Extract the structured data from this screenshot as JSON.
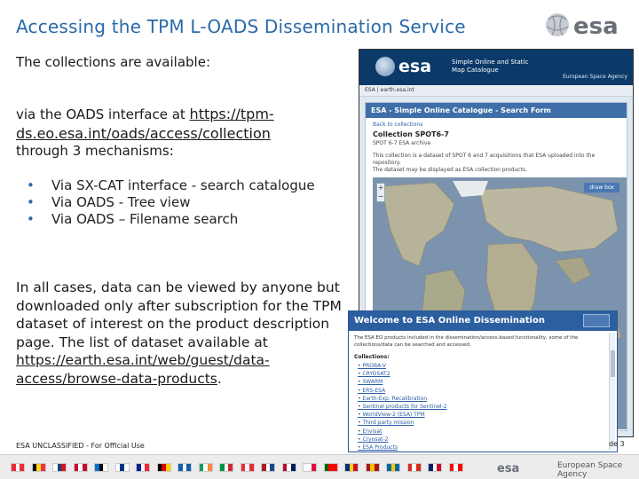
{
  "slide": {
    "title": "Accessing the TPM L-OADS Dissemination Service",
    "intro": "The collections are available:",
    "via_prefix": "via the OADS interface at ",
    "via_url": "https://tpm-ds.eo.esa.int/oads/access/collection",
    "mechanisms_intro": "through 3 mechanisms:",
    "bullets": [
      {
        "pre": "Via ",
        "em": "SX-CAT interface",
        "post": " - search catalogue"
      },
      {
        "pre": "Via ",
        "em": "OADS",
        "post": " - Tree view"
      },
      {
        "pre": "Via ",
        "em": "OADS",
        "post": " – Filename search"
      }
    ],
    "paragraph_text": "In all cases, data can be viewed by anyone but downloaded only after subscription for the TPM dataset of interest on the product description page. The list of dataset available at ",
    "paragraph_link": "https://earth.esa.int/web/guest/data-access/browse-data-products",
    "paragraph_end": ".",
    "footer_left": "ESA UNCLASSIFIED - For Official Use",
    "footer_right": "de 3"
  },
  "catalogue_shot": {
    "logo": "esa",
    "header_sub": "Simple Online and Static Map Catalogue",
    "agency": "European Space Agency",
    "crumb": "ESA | earth.esa.int",
    "panel_title": "ESA - Simple Online Catalogue - Search Form",
    "back_link": "Back to collections",
    "collection": "Collection SPOT6-7",
    "collection_sub": "SPOT 6-7 ESA archive",
    "description_1": "This collection is a dataset of SPOT 6 and 7 acquisitions that ESA uploaded into the repository.",
    "description_2": "The dataset may be displayed as ESA collection products.",
    "draw_button": "draw box",
    "zoom": "+−"
  },
  "dissemination_shot": {
    "title": "Welcome to ESA Online Dissemination",
    "body": "The ESA EO products included in the dissemination/access-based functionality, some of the collections/data can be searched and accessed.",
    "collections_label": "Collections:",
    "collections": [
      "PROBA-V",
      "CRYOSAT2",
      "SWARM",
      "ERS-ESA",
      "Earth-Exp. Recalibration",
      "Sentinel products for Sentinel-2",
      "WorldView-2 (ESA) TPM",
      "Third party mission",
      "Envisat",
      "Cryosat-2",
      "ESA Products"
    ]
  },
  "bottom_bar": {
    "agency": "European Space Agency",
    "logo": "esa",
    "flags": [
      [
        "#ed2939",
        "#ffffff",
        "#ed2939"
      ],
      [
        "#000000",
        "#fdda24",
        "#ef3340"
      ],
      [
        "#ffffff",
        "#11457e",
        "#d7141a"
      ],
      [
        "#c60c30",
        "#ffffff",
        "#c60c30"
      ],
      [
        "#0072ce",
        "#000000",
        "#ffffff"
      ],
      [
        "#ffffff",
        "#003580",
        "#ffffff"
      ],
      [
        "#002395",
        "#ffffff",
        "#ed2939"
      ],
      [
        "#000000",
        "#dd0000",
        "#ffce00"
      ],
      [
        "#0d5eaf",
        "#ffffff",
        "#0d5eaf"
      ],
      [
        "#169b62",
        "#ffffff",
        "#ff883e"
      ],
      [
        "#009246",
        "#ffffff",
        "#ce2b37"
      ],
      [
        "#ed2939",
        "#ffffff",
        "#ed2939"
      ],
      [
        "#ae1c28",
        "#ffffff",
        "#21468b"
      ],
      [
        "#ba0c2f",
        "#ffffff",
        "#00205b"
      ],
      [
        "#ffffff",
        "#ffffff",
        "#dc143c"
      ],
      [
        "#006600",
        "#ff0000",
        "#ff0000"
      ],
      [
        "#002b7f",
        "#fcd116",
        "#ce1126"
      ],
      [
        "#aa151b",
        "#f1bf00",
        "#aa151b"
      ],
      [
        "#006aa7",
        "#fecc00",
        "#006aa7"
      ],
      [
        "#da291c",
        "#ffffff",
        "#da291c"
      ],
      [
        "#012169",
        "#ffffff",
        "#c8102e"
      ],
      [
        "#ff0000",
        "#ffffff",
        "#ff0000"
      ]
    ]
  }
}
